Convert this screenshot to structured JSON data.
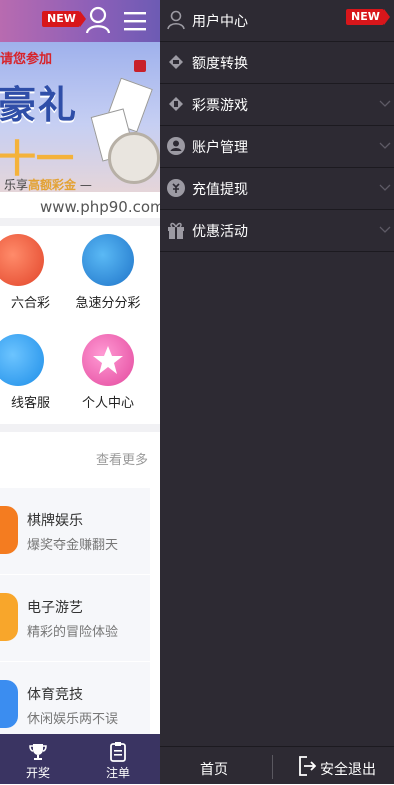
{
  "header": {
    "new_badge": "NEW"
  },
  "banner": {
    "slogan": "请您参加",
    "headline_1": "豪礼",
    "headline_2": "十一",
    "tagline_prefix": "乐享",
    "tagline_highlight": "高额彩金",
    "tagline_suffix": "—"
  },
  "watermark": "www.php90.com",
  "quick_grid": [
    {
      "label": "六合彩",
      "icon": "lottery-six-icon"
    },
    {
      "label": "急速分分彩",
      "icon": "fast-lottery-icon"
    },
    {
      "label": "线客服",
      "icon": "customer-service-icon"
    },
    {
      "label": "个人中心",
      "icon": "personal-center-icon"
    }
  ],
  "section": {
    "see_more": "查看更多"
  },
  "game_cards": [
    {
      "title": "棋牌娱乐",
      "desc": "爆奖夺金赚翻天",
      "color": "#f47c20"
    },
    {
      "title": "电子游艺",
      "desc": "精彩的冒险体验",
      "color": "#f8a62b"
    },
    {
      "title": "体育竞技",
      "desc": "休闲娱乐两不误",
      "color": "#3b8df0"
    }
  ],
  "bottom_nav": [
    {
      "label": "开奖",
      "icon": "trophy-icon"
    },
    {
      "label": "注单",
      "icon": "order-list-icon"
    }
  ],
  "drawer": {
    "new_badge": "NEW",
    "items": [
      {
        "label": "用户中心",
        "icon": "user-icon",
        "has_chevron": false
      },
      {
        "label": "额度转换",
        "icon": "transfer-icon",
        "has_chevron": false
      },
      {
        "label": "彩票游戏",
        "icon": "ticket-icon",
        "has_chevron": true
      },
      {
        "label": "账户管理",
        "icon": "account-icon",
        "has_chevron": true
      },
      {
        "label": "充值提现",
        "icon": "wallet-icon",
        "has_chevron": true
      },
      {
        "label": "优惠活动",
        "icon": "gift-icon",
        "has_chevron": true
      }
    ],
    "footer": {
      "home": "首页",
      "logout": "安全退出"
    }
  },
  "colors": {
    "drawer_bg": "#2d2a33",
    "bottom_nav_bg": "#3a3462",
    "header_gradient": "#8b5fb8",
    "badge_red": "#d8161b"
  }
}
